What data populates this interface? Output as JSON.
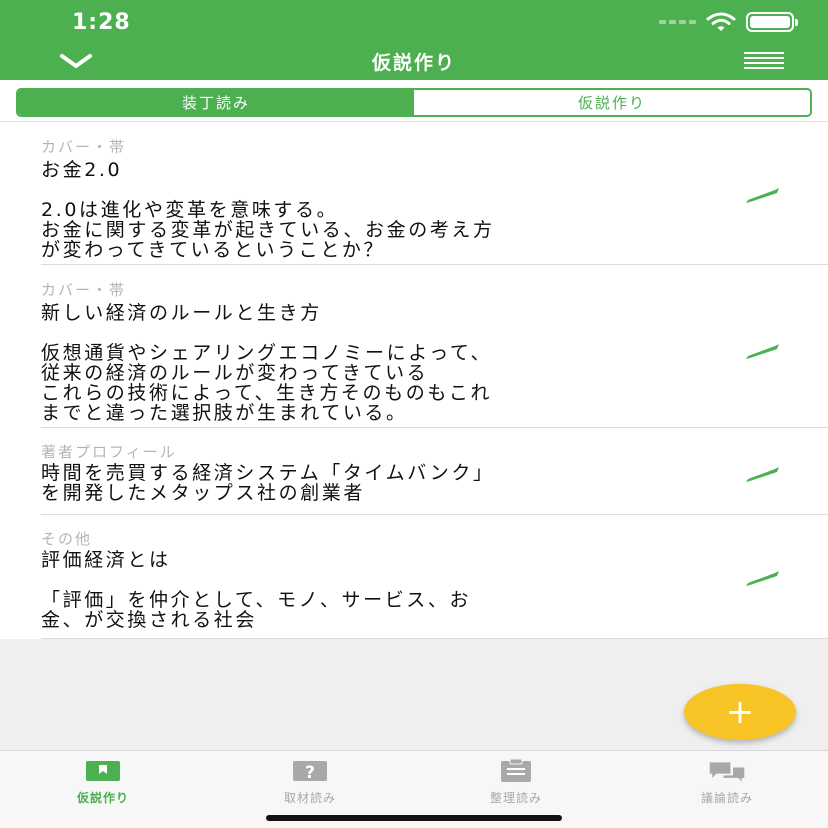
{
  "status": {
    "time": "1:28"
  },
  "nav": {
    "title": "仮説作り",
    "back_icon": "chevron-down-icon",
    "menu_icon": "menu-icon"
  },
  "segments": [
    {
      "label": "装丁読み",
      "active": true
    },
    {
      "label": "仮説作り",
      "active": false
    }
  ],
  "cards": [
    {
      "category": "カバー・帯",
      "body": "お金2.0\n\n2.0は進化や変革を意味する。\nお金に関する変革が起きている、お金の考え方\nが変わってきているということか？"
    },
    {
      "category": "カバー・帯",
      "body": "新しい経済のルールと生き方\n\n仮想通貨やシェアリングエコノミーによって、\n従来の経済のルールが変わってきている\nこれらの技術によって、生き方そのものもこれ\nまでと違った選択肢が生まれている。"
    },
    {
      "category": "著者プロフィール",
      "body": "時間を売買する経済システム「タイムバンク」\nを開発したメタップス社の創業者"
    },
    {
      "category": "その他",
      "body": "評価経済とは\n\n「評価」を仲介として、モノ、サービス、お\n金、が交換される社会"
    }
  ],
  "fab": {
    "label": "+"
  },
  "tabs": [
    {
      "label": "仮説作り",
      "icon": "flag-icon",
      "active": true
    },
    {
      "label": "取材読み",
      "icon": "question-icon",
      "active": false
    },
    {
      "label": "整理読み",
      "icon": "clipboard-icon",
      "active": false
    },
    {
      "label": "議論読み",
      "icon": "chat-bubbles-icon",
      "active": false
    }
  ],
  "colors": {
    "primary": "#4caf50",
    "accent": "#f7c325",
    "tab_inactive": "#a8a8a8"
  }
}
